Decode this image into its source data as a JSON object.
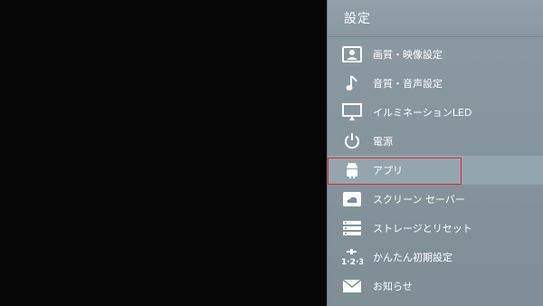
{
  "panel": {
    "title": "設定"
  },
  "menu": {
    "items": [
      {
        "id": "picture",
        "label": "画質・映像設定",
        "icon": "picture-icon"
      },
      {
        "id": "sound",
        "label": "音質・音声設定",
        "icon": "music-note-icon"
      },
      {
        "id": "illumination",
        "label": "イルミネーションLED",
        "icon": "monitor-icon"
      },
      {
        "id": "power",
        "label": "電源",
        "icon": "power-icon"
      },
      {
        "id": "apps",
        "label": "アプリ",
        "icon": "android-icon",
        "selected": true
      },
      {
        "id": "screensaver",
        "label": "スクリーン セーバー",
        "icon": "screensaver-icon"
      },
      {
        "id": "storage",
        "label": "ストレージとリセット",
        "icon": "storage-icon"
      },
      {
        "id": "setup",
        "label": "かんたん初期設定",
        "icon": "setup-123-icon"
      },
      {
        "id": "notice",
        "label": "お知らせ",
        "icon": "mail-icon"
      }
    ]
  },
  "colors": {
    "panel_bg": "#8c9aa3",
    "focus_ring": "#e0262f",
    "text": "#ffffff"
  }
}
